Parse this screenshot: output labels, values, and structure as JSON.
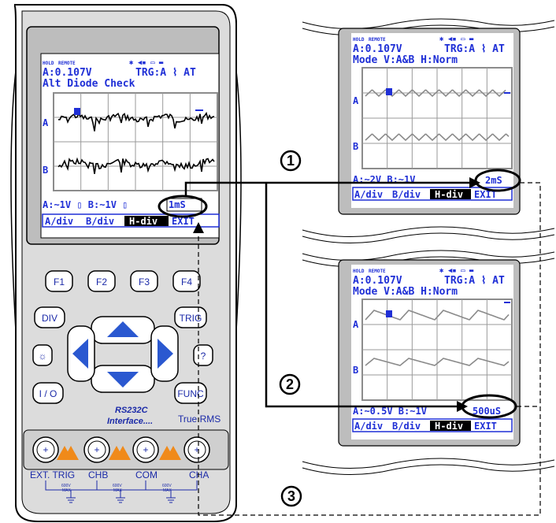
{
  "colors": {
    "lcd_text": "#1f2fd6",
    "lcd_bg": "#ffffff",
    "frame": "#000000",
    "trace": "#000000",
    "grid": "#a0a0a0",
    "softkey_dark": "#000000"
  },
  "main_screen": {
    "status_left": "HOLD",
    "status_mid": "REMOTE",
    "reading": "A:0.107V",
    "trigger": "TRG:A ⌇ AT",
    "mode": "Alt Diode Check",
    "label_a": "A",
    "label_b": "B",
    "scale": "A:~1V  ▯ B:~1V ▯",
    "timebase": "1mS",
    "softkeys": [
      "A/div",
      "B/div",
      "H-div",
      "EXIT"
    ]
  },
  "panel_top": {
    "status_left": "HOLD",
    "status_mid": "REMOTE",
    "reading": "A:0.107V",
    "trigger": "TRG:A ⌇ AT",
    "mode": "Mode V:A&B H:Norm",
    "label_a": "A",
    "label_b": "B",
    "scale": "A:~2V   B:~1V",
    "timebase": "2mS",
    "softkeys": [
      "A/div",
      "B/div",
      "H-div",
      "EXIT"
    ]
  },
  "panel_bottom": {
    "status_left": "HOLD",
    "status_mid": "REMOTE",
    "reading": "A:0.107V",
    "trigger": "TRG:A ⌇ AT",
    "mode": "Mode V:A&B H:Norm",
    "label_a": "A",
    "label_b": "B",
    "scale": "A:~0.5V  B:~1V",
    "timebase": "500uS",
    "softkeys": [
      "A/div",
      "B/div",
      "H-div",
      "EXIT"
    ]
  },
  "function_keys": [
    "F1",
    "F2",
    "F3",
    "F4"
  ],
  "keys": {
    "div": "DIV",
    "trig": "TRIG",
    "io": "I / O",
    "func": "FUNC",
    "help": "?"
  },
  "rs232": {
    "line1": "RS232C",
    "line2": "Interface....",
    "true_rms": "True RMS"
  },
  "terminals": {
    "labels": [
      "EXT. TRIG",
      "CHB",
      "COM",
      "CHA"
    ],
    "plus": "+",
    "max_rating": "600V",
    "max_word": "MAX"
  },
  "callouts": [
    "1",
    "2",
    "3"
  ]
}
